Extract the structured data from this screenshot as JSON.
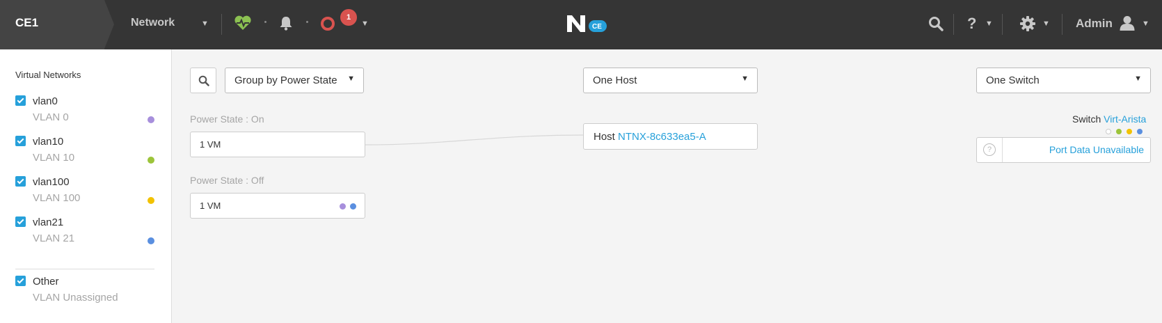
{
  "header": {
    "cluster_name": "CE1",
    "menu_label": "Network",
    "alert_count": "1",
    "logo_badge": "CE",
    "user_label": "Admin"
  },
  "sidebar": {
    "title": "Virtual Networks",
    "networks": [
      {
        "name": "vlan0",
        "vlan": "VLAN 0",
        "color": "#a78fdc"
      },
      {
        "name": "vlan10",
        "vlan": "VLAN 10",
        "color": "#9cc43a"
      },
      {
        "name": "vlan100",
        "vlan": "VLAN 100",
        "color": "#f2c200"
      },
      {
        "name": "vlan21",
        "vlan": "VLAN 21",
        "color": "#5a8fe0"
      }
    ],
    "other": {
      "name": "Other",
      "vlan": "VLAN Unassigned"
    }
  },
  "toolbar": {
    "group_by": "Group by Power State",
    "host_select": "One Host",
    "switch_select": "One Switch"
  },
  "groups": [
    {
      "label": "Power State : On",
      "vm_count": "1 VM"
    },
    {
      "label": "Power State : Off",
      "vm_count": "1 VM",
      "dot_colors": [
        "#a78fdc",
        "#5a8fe0"
      ]
    }
  ],
  "host": {
    "prefix": "Host",
    "name": "NTNX-8c633ea5-A"
  },
  "switch": {
    "prefix": "Switch",
    "name": "Virt-Arista",
    "dot_colors": [
      "#ffffff",
      "#9cc43a",
      "#f2c200",
      "#5a8fe0"
    ],
    "port_status": "Port Data Unavailable"
  },
  "colors": {
    "accent": "#26a0da",
    "alert": "#d9534f",
    "health": "#8cc152",
    "topbar": "#353535"
  }
}
